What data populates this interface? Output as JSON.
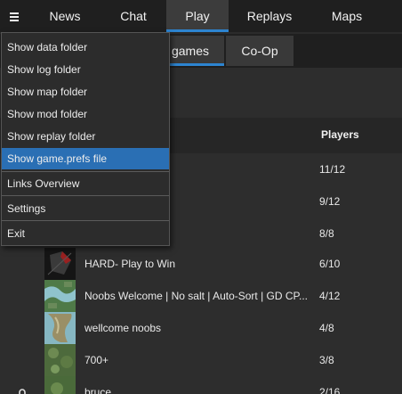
{
  "nav": {
    "tabs": [
      {
        "label": "News"
      },
      {
        "label": "Chat"
      },
      {
        "label": "Play"
      },
      {
        "label": "Replays"
      },
      {
        "label": "Maps"
      }
    ],
    "active_tab": "Play"
  },
  "subtabs": [
    {
      "label": "games"
    },
    {
      "label": "Co-Op"
    }
  ],
  "table": {
    "players_header": "Players",
    "rows": [
      {
        "title": "",
        "players": "11/12"
      },
      {
        "title": "",
        "players": "9/12"
      },
      {
        "title": "",
        "players": "8/8"
      },
      {
        "title": "HARD- Play to Win",
        "players": "6/10"
      },
      {
        "title": "Noobs Welcome | No salt | Auto-Sort | GD CP...",
        "players": "4/12"
      },
      {
        "title": "wellcome noobs",
        "players": "4/8"
      },
      {
        "title": "700+",
        "players": "3/8"
      },
      {
        "title": "bruce",
        "players": "2/16"
      }
    ]
  },
  "menu": {
    "items": [
      {
        "label": "Show data folder"
      },
      {
        "label": "Show log folder"
      },
      {
        "label": "Show map folder"
      },
      {
        "label": "Show mod folder"
      },
      {
        "label": "Show replay folder"
      },
      {
        "label": "Show game.prefs file"
      },
      {
        "label": "Links Overview"
      },
      {
        "label": "Settings"
      },
      {
        "label": "Exit"
      }
    ],
    "selected_item": "Show game.prefs file"
  },
  "colors": {
    "accent": "#2d84d0",
    "menu_highlight": "#2a6fb4"
  }
}
